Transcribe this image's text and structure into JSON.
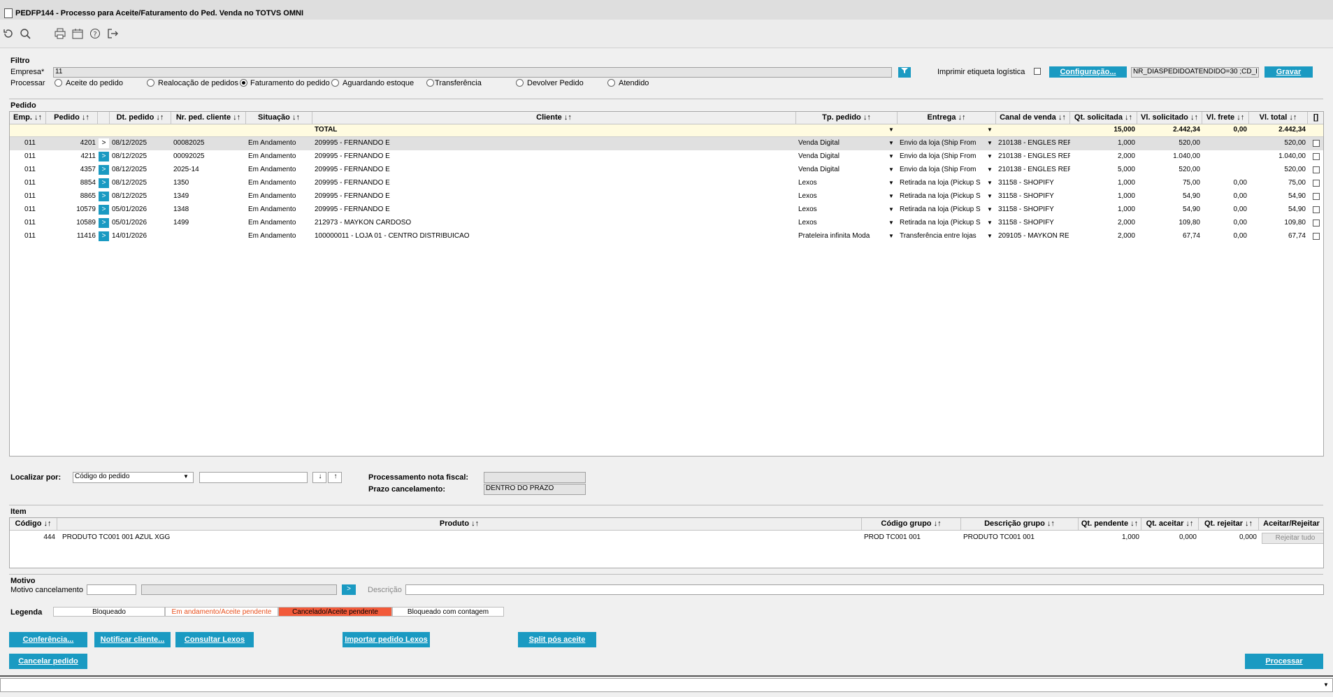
{
  "window": {
    "title": "PEDFP144 - Processo para Aceite/Faturamento do Ped. Venda no TOTVS OMNI"
  },
  "toolbar": {
    "icons": [
      "refresh-icon",
      "search-icon",
      "print-icon",
      "calendar-icon",
      "help-icon",
      "exit-icon"
    ]
  },
  "filtro": {
    "section_label": "Filtro",
    "empresa_label": "Empresa*",
    "empresa_value": "11",
    "imprimir_label": "Imprimir etiqueta logística",
    "config_button": "Configuração...",
    "config_value": "NR_DIASPEDIDOATENDIDO=30 ;CD_I",
    "gravar_button": "Gravar",
    "processar_label": "Processar",
    "options": [
      "Aceite do pedido",
      "Realocação de pedidos",
      "Faturamento do pedido",
      "Aguardando estoque",
      "Transferência",
      "Devolver Pedido",
      "Atendido"
    ],
    "selected_option": "Faturamento do pedido"
  },
  "pedido": {
    "section_label": "Pedido",
    "columns": [
      "Emp. ↓↑",
      "Pedido ↓↑",
      "Dt. pedido ↓↑",
      "Nr. ped. cliente ↓↑",
      "Situação ↓↑",
      "Cliente ↓↑",
      "Tp. pedido ↓↑",
      "Entrega ↓↑",
      "Canal de venda ↓↑",
      "Qt. solicitada ↓↑",
      "Vl. solicitado ↓↑",
      "Vl. frete ↓↑",
      "Vl. total ↓↑",
      "[]"
    ],
    "total": {
      "label": "TOTAL",
      "qt": "15,000",
      "vl_solicitado": "2.442,34",
      "vl_frete": "0,00",
      "vl_total": "2.442,34"
    },
    "rows": [
      {
        "emp": "011",
        "pedido": "4201",
        "dt": "08/12/2025",
        "nr": "00082025",
        "situacao": "Em Andamento",
        "cliente": "209995 - FERNANDO E",
        "tp": "Venda Digital",
        "entrega": "Envio da loja (Ship From",
        "canal": "210138 - ENGLES REP",
        "qt": "1,000",
        "vl_sol": "520,00",
        "frete": "",
        "total": "520,00",
        "arrow": "plain"
      },
      {
        "emp": "011",
        "pedido": "4211",
        "dt": "08/12/2025",
        "nr": "00092025",
        "situacao": "Em Andamento",
        "cliente": "209995 - FERNANDO E",
        "tp": "Venda Digital",
        "entrega": "Envio da loja (Ship From",
        "canal": "210138 - ENGLES REP",
        "qt": "2,000",
        "vl_sol": "1.040,00",
        "frete": "",
        "total": "1.040,00",
        "arrow": "blue"
      },
      {
        "emp": "011",
        "pedido": "4357",
        "dt": "08/12/2025",
        "nr": "2025-14",
        "situacao": "Em Andamento",
        "cliente": "209995 - FERNANDO E",
        "tp": "Venda Digital",
        "entrega": "Envio da loja (Ship From",
        "canal": "210138 - ENGLES REP",
        "qt": "5,000",
        "vl_sol": "520,00",
        "frete": "",
        "total": "520,00",
        "arrow": "blue"
      },
      {
        "emp": "011",
        "pedido": "8854",
        "dt": "08/12/2025",
        "nr": "1350",
        "situacao": "Em Andamento",
        "cliente": "209995 - FERNANDO E",
        "tp": "Lexos",
        "entrega": "Retirada na loja (Pickup S",
        "canal": "31158 - SHOPIFY",
        "qt": "1,000",
        "vl_sol": "75,00",
        "frete": "0,00",
        "total": "75,00",
        "arrow": "blue"
      },
      {
        "emp": "011",
        "pedido": "8865",
        "dt": "08/12/2025",
        "nr": "1349",
        "situacao": "Em Andamento",
        "cliente": "209995 - FERNANDO E",
        "tp": "Lexos",
        "entrega": "Retirada na loja (Pickup S",
        "canal": "31158 - SHOPIFY",
        "qt": "1,000",
        "vl_sol": "54,90",
        "frete": "0,00",
        "total": "54,90",
        "arrow": "blue"
      },
      {
        "emp": "011",
        "pedido": "10579",
        "dt": "05/01/2026",
        "nr": "1348",
        "situacao": "Em Andamento",
        "cliente": "209995 - FERNANDO E",
        "tp": "Lexos",
        "entrega": "Retirada na loja (Pickup S",
        "canal": "31158 - SHOPIFY",
        "qt": "1,000",
        "vl_sol": "54,90",
        "frete": "0,00",
        "total": "54,90",
        "arrow": "blue"
      },
      {
        "emp": "011",
        "pedido": "10589",
        "dt": "05/01/2026",
        "nr": "1499",
        "situacao": "Em Andamento",
        "cliente": "212973 - MAYKON CARDOSO",
        "tp": "Lexos",
        "entrega": "Retirada na loja (Pickup S",
        "canal": "31158 - SHOPIFY",
        "qt": "2,000",
        "vl_sol": "109,80",
        "frete": "0,00",
        "total": "109,80",
        "arrow": "blue"
      },
      {
        "emp": "011",
        "pedido": "11416",
        "dt": "14/01/2026",
        "nr": "",
        "situacao": "Em Andamento",
        "cliente": "100000011 - LOJA 01 - CENTRO DISTRIBUICAO",
        "tp": "Prateleira infinita Moda",
        "entrega": "Transferência entre lojas",
        "canal": "209105 - MAYKON RE",
        "qt": "2,000",
        "vl_sol": "67,74",
        "frete": "0,00",
        "total": "67,74",
        "arrow": "blue"
      }
    ]
  },
  "localizar": {
    "label": "Localizar por:",
    "select_value": "Código do pedido",
    "search_value": "",
    "sort_down": "↓",
    "sort_up": "↑",
    "proc_nf_label": "Processamento nota fiscal:",
    "proc_nf_value": "",
    "prazo_label": "Prazo cancelamento:",
    "prazo_value": "DENTRO DO PRAZO"
  },
  "item": {
    "section_label": "Item",
    "columns": [
      "Código ↓↑",
      "Produto ↓↑",
      "Código grupo ↓↑",
      "Descrição grupo ↓↑",
      "Qt. pendente ↓↑",
      "Qt. aceitar ↓↑",
      "Qt. rejeitar ↓↑",
      "Aceitar/Rejeitar"
    ],
    "rows": [
      {
        "codigo": "444",
        "produto": "PRODUTO TC001 001 AZUL XGG",
        "cod_grupo": "PROD TC001 001",
        "desc_grupo": "PRODUTO TC001 001",
        "qt_pend": "1,000",
        "qt_aceitar": "0,000",
        "qt_rejeitar": "0,000"
      }
    ],
    "rejeitar_tudo": "Rejeitar tudo"
  },
  "motivo": {
    "section_label": "Motivo",
    "cancel_label": "Motivo cancelamento",
    "codigo_value": "",
    "desc_value": "",
    "descricao_label": "Descrição",
    "descricao_value": ""
  },
  "legenda": {
    "label": "Legenda",
    "items": [
      {
        "text": "Bloqueado",
        "color": "#000000",
        "bg": "#ffffff"
      },
      {
        "text": "Em andamento/Aceite pendente",
        "color": "#e8501e",
        "bg": "#ffffff"
      },
      {
        "text": "Cancelado/Aceite pendente",
        "color": "#000000",
        "bg": "#f25a3a"
      },
      {
        "text": "Bloqueado com contagem",
        "color": "#000000",
        "bg": "#ffffff"
      }
    ]
  },
  "buttons": {
    "conferencia": "Conferência...",
    "notificar": "Notificar cliente...",
    "consultar": "Consultar Lexos",
    "importar": "Importar pedido Lexos",
    "split": "Split pós aceite",
    "cancelar": "Cancelar pedido",
    "processar": "Processar"
  },
  "colors": {
    "accent": "#1a9ac2",
    "total_row": "#fffbe0",
    "selected_row": "#e0e0e0"
  }
}
